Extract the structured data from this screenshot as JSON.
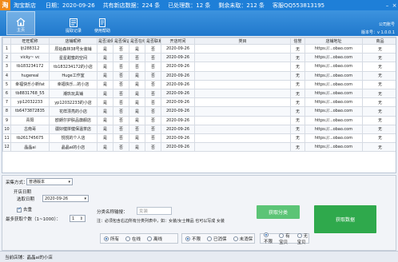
{
  "titlebar": {
    "logo": "淘",
    "app_name": "淘宝新店",
    "date_label": "日期：",
    "date_value": "2020-09-26",
    "count_text": "共有新店数据：224 条",
    "processed_text": "已处理数：12 条",
    "remaining_text": "剩余未取：212 条",
    "contact": "客服QQ553813195"
  },
  "toolbar": {
    "buttons": [
      {
        "label": "主页"
      },
      {
        "label": "提取记录"
      },
      {
        "label": "使用帮助"
      }
    ],
    "company_label": "公司账号",
    "version": "版本号：v 1.0.0.1"
  },
  "table": {
    "columns": [
      "",
      "旺旺昵称",
      "店铺昵称",
      "是否消保",
      "是否保证",
      "是否在线",
      "是否联系",
      "开店时间",
      "类目",
      "信誉",
      "店铺地址",
      "商品"
    ],
    "rows": [
      [
        "1",
        "ljt288312",
        "原始森林38号女装铺",
        "是",
        "否",
        "是",
        "否",
        "2020-09-26",
        "",
        "无",
        "https://...obao.com",
        "无"
      ],
      [
        "2",
        "vicky~ vc",
        "星星甜蜜的空间",
        "是",
        "否",
        "否",
        "否",
        "2020-09-26",
        "",
        "无",
        "https://...obao.com",
        "无"
      ],
      [
        "3",
        "tb183234172",
        "tb183234172的小店",
        "是",
        "否",
        "否",
        "否",
        "2020-09-26",
        "",
        "无",
        "https://...obao.com",
        "无"
      ],
      [
        "4",
        "hugereal",
        "Huge工作室",
        "是",
        "否",
        "是",
        "否",
        "2020-09-26",
        "",
        "无",
        "https://...obao.com",
        "无"
      ],
      [
        "5",
        "幸福快乐小新fat",
        "幸福快乐...的小店",
        "是",
        "否",
        "是",
        "否",
        "2020-09-26",
        "",
        "无",
        "https://...obao.com",
        "无"
      ],
      [
        "6",
        "tb8831768_55",
        "潮玖玩具铺",
        "是",
        "否",
        "是",
        "否",
        "2020-09-26",
        "",
        "无",
        "https://...obao.com",
        "无"
      ],
      [
        "7",
        "yp12032233",
        "yp12032233的小店",
        "是",
        "否",
        "是",
        "否",
        "2020-09-26",
        "",
        "无",
        "https://...obao.com",
        "无"
      ],
      [
        "8",
        "tb6473872835",
        "花样漂亮的小店",
        "是",
        "否",
        "是",
        "否",
        "2020-09-26",
        "",
        "无",
        "https://...obao.com",
        "无"
      ],
      [
        "9",
        "青阳",
        "欧朗尔护肤品旗舰店",
        "是",
        "否",
        "是",
        "否",
        "2020-09-26",
        "",
        "无",
        "https://...obao.com",
        "无"
      ],
      [
        "10",
        "古南哥",
        "疆好健拼健保温茶店",
        "是",
        "否",
        "否",
        "否",
        "2020-09-26",
        "",
        "无",
        "https://...obao.com",
        "无"
      ],
      [
        "11",
        "tb261745675",
        "悦悦的个人店",
        "是",
        "否",
        "是",
        "否",
        "2020-09-26",
        "",
        "无",
        "https://...obao.com",
        "无"
      ],
      [
        "12",
        "晶晶ai",
        "晶晶ai的小店",
        "是",
        "否",
        "是",
        "否",
        "2020-09-26",
        "",
        "无",
        "https://...obao.com",
        "无"
      ]
    ]
  },
  "controls": {
    "collect_mode_label": "采集方式：",
    "collect_mode_value": "普通版本",
    "open_date_label": "开店日期",
    "choose_date_label": "选取日期",
    "date_value": "2020-09-26",
    "checkbox_label": "去重",
    "max_label": "最多获取个数（1~1000）：",
    "max_value": "1",
    "category_label": "分类名称输搜：",
    "category_placeholder": "女装",
    "hint": "注：必须包含右边所有分类列表中，如：女装/女士精品 也可以写成 女装",
    "collect_btn": "获取分类",
    "fetch_btn": "获取数据",
    "radio_group_1": [
      {
        "label": "所有",
        "selected": true
      },
      {
        "label": "在线",
        "selected": false
      },
      {
        "label": "离线",
        "selected": false
      }
    ],
    "radio_group_2": [
      {
        "label": "不限",
        "selected": true
      },
      {
        "label": "已消保",
        "selected": false
      },
      {
        "label": "未消保",
        "selected": false
      }
    ],
    "radio_group_3": [
      {
        "label": "不限",
        "selected": true
      },
      {
        "label": "有宝贝",
        "selected": false
      },
      {
        "label": "无宝贝",
        "selected": false
      }
    ]
  },
  "status": {
    "text": "当前店铺：晶晶ai的小店"
  },
  "colors": {
    "brand": "#1e7fd8",
    "green_light": "#4fc06a",
    "green_dark": "#2ea64a"
  }
}
